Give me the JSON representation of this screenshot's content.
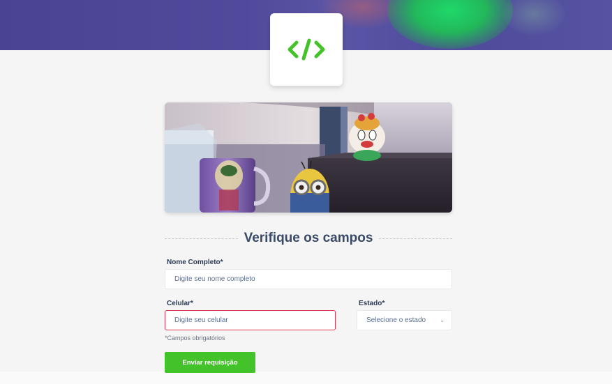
{
  "logo": {
    "icon": "code-brackets-icon",
    "color": "#44c22a"
  },
  "form": {
    "title": "Verifique os campos",
    "name": {
      "label": "Nome Completo*",
      "placeholder": "Digite seu nome completo"
    },
    "phone": {
      "label": "Celular*",
      "placeholder": "Digite seu celular",
      "state": "error"
    },
    "state": {
      "label": "Estado*",
      "selected": "Selecione o estado"
    },
    "required_note": "*Campos obrigatórios",
    "submit_label": "Enviar requisição"
  },
  "colors": {
    "header": "#514a9c",
    "accent": "#44c22a",
    "error_border": "#e0344f",
    "title": "#3a4a66"
  }
}
